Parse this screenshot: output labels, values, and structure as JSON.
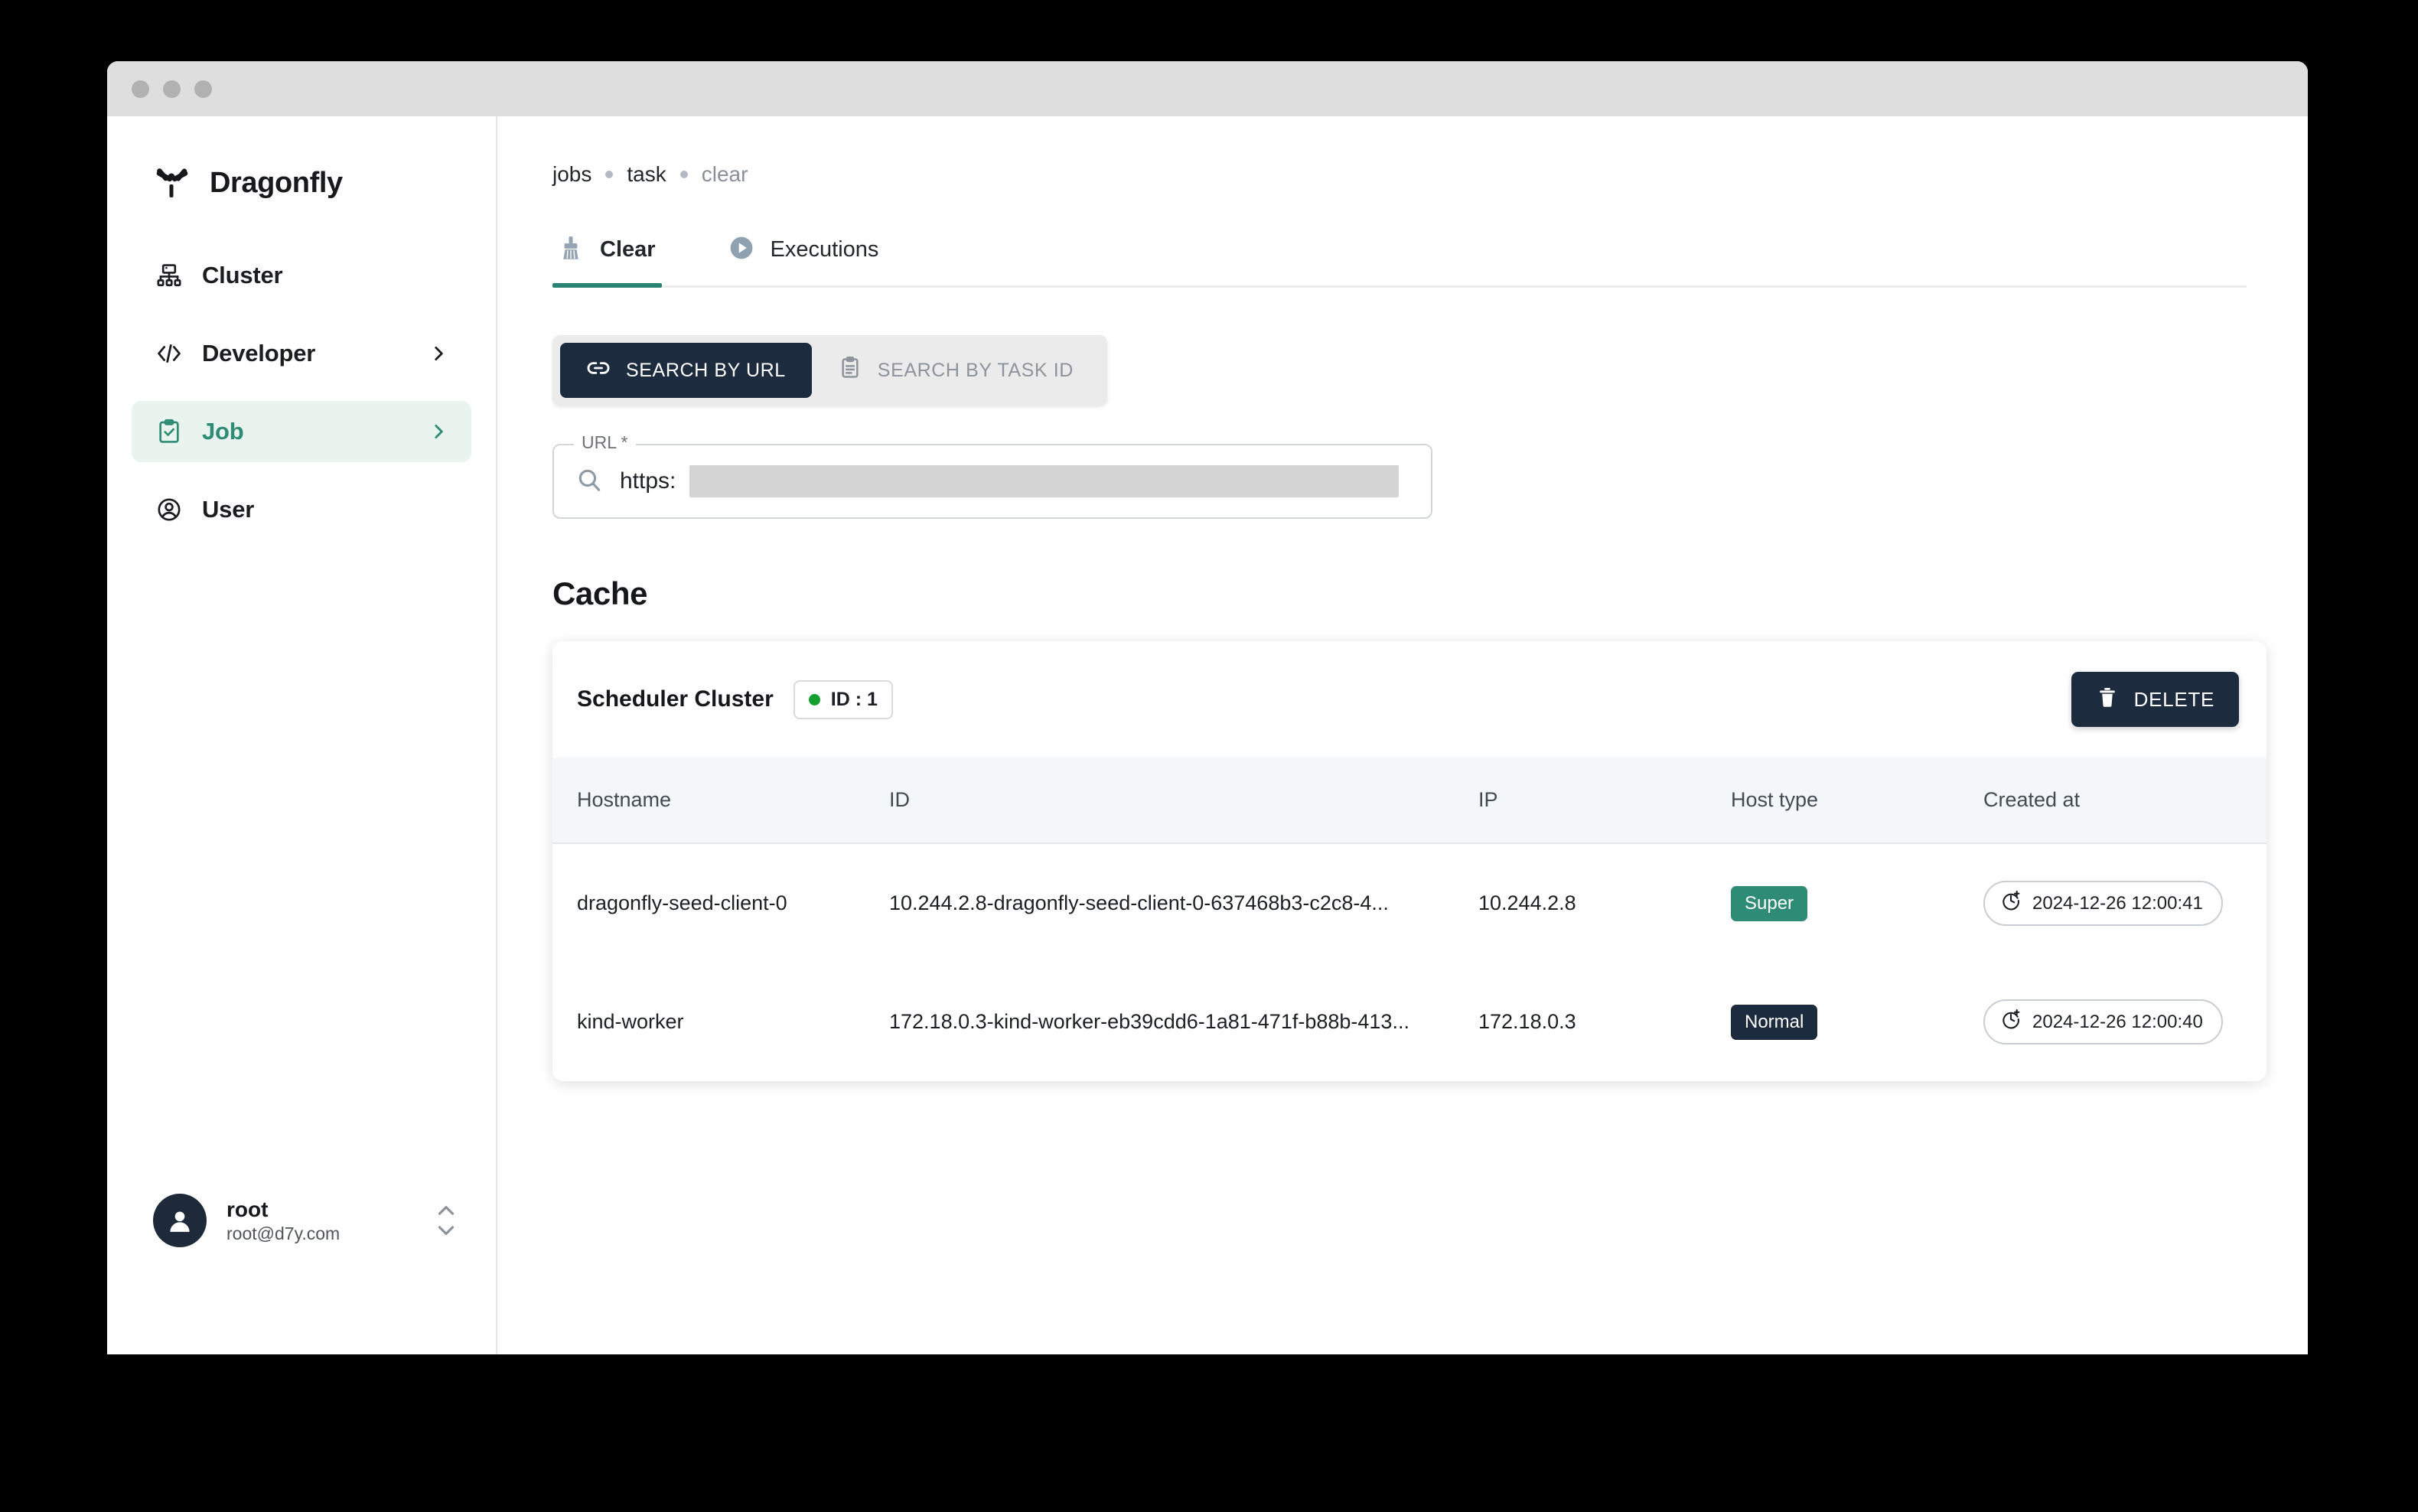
{
  "window": {
    "traffic_lights": [
      "close",
      "minimize",
      "maximize"
    ]
  },
  "sidebar": {
    "brand": {
      "name": "Dragonfly",
      "logo_icon": "dragonfly-logo-icon"
    },
    "items": [
      {
        "label": "Cluster",
        "icon": "cluster-icon",
        "has_chevron": false,
        "active": false
      },
      {
        "label": "Developer",
        "icon": "code-icon",
        "has_chevron": true,
        "active": false
      },
      {
        "label": "Job",
        "icon": "clipboard-check-icon",
        "has_chevron": true,
        "active": true
      },
      {
        "label": "User",
        "icon": "user-circle-icon",
        "has_chevron": false,
        "active": false
      }
    ],
    "user": {
      "name": "root",
      "email": "root@d7y.com",
      "avatar_icon": "avatar-icon",
      "expand_icon": "chevron-up-down-icon"
    }
  },
  "breadcrumb": {
    "items": [
      "jobs",
      "task",
      "clear"
    ]
  },
  "tabs": [
    {
      "label": "Clear",
      "icon": "broom-icon",
      "active": true
    },
    {
      "label": "Executions",
      "icon": "play-circle-icon",
      "active": false
    }
  ],
  "search_toggle": {
    "options": [
      {
        "label": "SEARCH BY URL",
        "icon": "link-icon",
        "active": true
      },
      {
        "label": "SEARCH BY TASK ID",
        "icon": "clipboard-icon",
        "active": false
      }
    ]
  },
  "url_field": {
    "legend": "URL *",
    "icon": "search-icon",
    "value": "https:",
    "redacted": true
  },
  "cache": {
    "title": "Cache",
    "cluster": {
      "name": "Scheduler Cluster",
      "id_chip": "ID : 1",
      "status_color": "#14a02e"
    },
    "delete_button": {
      "label": "DELETE",
      "icon": "trash-icon"
    },
    "table": {
      "columns": [
        "Hostname",
        "ID",
        "IP",
        "Host type",
        "Created at"
      ],
      "rows": [
        {
          "hostname": "dragonfly-seed-client-0",
          "id": "10.244.2.8-dragonfly-seed-client-0-637468b3-c2c8-4...",
          "ip": "10.244.2.8",
          "host_type": "Super",
          "host_type_color": "#2e8b74",
          "created_at": "2024-12-26 12:00:41",
          "created_icon": "clock-plus-icon"
        },
        {
          "hostname": "kind-worker",
          "id": "172.18.0.3-kind-worker-eb39cdd6-1a81-471f-b88b-413...",
          "ip": "172.18.0.3",
          "host_type": "Normal",
          "host_type_color": "#1d2b3e",
          "created_at": "2024-12-26 12:00:40",
          "created_icon": "clock-plus-icon"
        }
      ]
    }
  },
  "colors": {
    "accent_green": "#2e8b74",
    "accent_green_bg": "#e9f4ef",
    "navy": "#1d2b3e",
    "tab_underline": "#2b8374",
    "table_header_bg": "#f4f7f9"
  }
}
